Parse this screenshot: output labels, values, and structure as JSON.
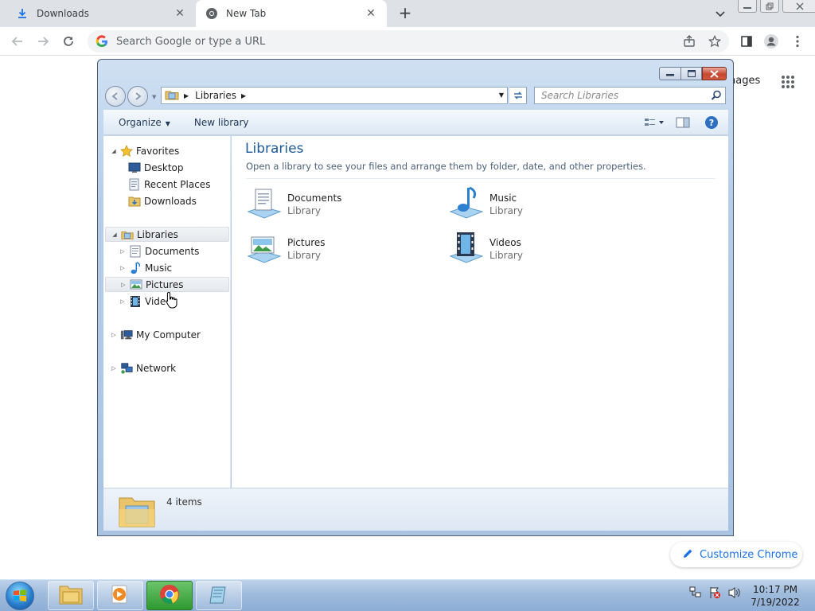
{
  "chrome": {
    "tabs": [
      {
        "title": "Downloads",
        "icon": "download-icon"
      },
      {
        "title": "New Tab",
        "icon": "chrome-icon"
      }
    ],
    "tab_close": "✕",
    "new_tab": "+",
    "omnibox_placeholder": "Search Google or type a URL",
    "ntp_images_link": "nages",
    "customize_label": "Customize Chrome",
    "accent_color": "#1a73e8"
  },
  "explorer": {
    "breadcrumb": [
      "Libraries"
    ],
    "search_placeholder": "Search Libraries",
    "toolbar": {
      "organize": "Organize",
      "new_library": "New library"
    },
    "nav": {
      "favorites": {
        "label": "Favorites",
        "items": [
          "Desktop",
          "Recent Places",
          "Downloads"
        ]
      },
      "libraries": {
        "label": "Libraries",
        "items": [
          "Documents",
          "Music",
          "Pictures",
          "Vide"
        ]
      },
      "computer": "My Computer",
      "network": "Network"
    },
    "content": {
      "heading": "Libraries",
      "subtitle": "Open a library to see your files and arrange them by folder, date, and other properties.",
      "libraries": [
        {
          "name": "Documents",
          "type": "Library",
          "icon": "documents-library-icon"
        },
        {
          "name": "Music",
          "type": "Library",
          "icon": "music-library-icon"
        },
        {
          "name": "Pictures",
          "type": "Library",
          "icon": "pictures-library-icon"
        },
        {
          "name": "Videos",
          "type": "Library",
          "icon": "videos-library-icon"
        }
      ]
    },
    "details": {
      "count": "4 items"
    }
  },
  "taskbar": {
    "time": "10:17 PM",
    "date": "7/19/2022"
  }
}
